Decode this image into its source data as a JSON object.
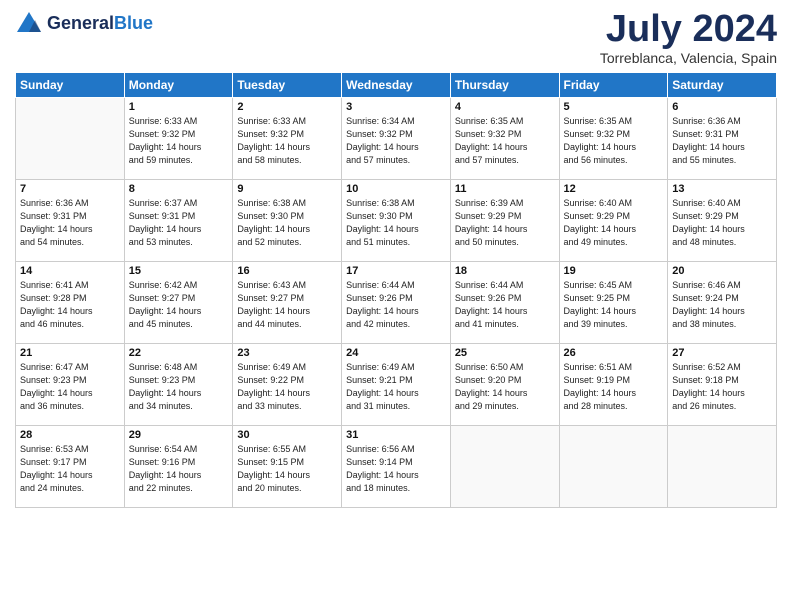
{
  "header": {
    "logo_line1": "General",
    "logo_line2": "Blue",
    "month_title": "July 2024",
    "location": "Torreblanca, Valencia, Spain"
  },
  "days_of_week": [
    "Sunday",
    "Monday",
    "Tuesday",
    "Wednesday",
    "Thursday",
    "Friday",
    "Saturday"
  ],
  "weeks": [
    [
      {
        "day": "",
        "info": ""
      },
      {
        "day": "1",
        "info": "Sunrise: 6:33 AM\nSunset: 9:32 PM\nDaylight: 14 hours\nand 59 minutes."
      },
      {
        "day": "2",
        "info": "Sunrise: 6:33 AM\nSunset: 9:32 PM\nDaylight: 14 hours\nand 58 minutes."
      },
      {
        "day": "3",
        "info": "Sunrise: 6:34 AM\nSunset: 9:32 PM\nDaylight: 14 hours\nand 57 minutes."
      },
      {
        "day": "4",
        "info": "Sunrise: 6:35 AM\nSunset: 9:32 PM\nDaylight: 14 hours\nand 57 minutes."
      },
      {
        "day": "5",
        "info": "Sunrise: 6:35 AM\nSunset: 9:32 PM\nDaylight: 14 hours\nand 56 minutes."
      },
      {
        "day": "6",
        "info": "Sunrise: 6:36 AM\nSunset: 9:31 PM\nDaylight: 14 hours\nand 55 minutes."
      }
    ],
    [
      {
        "day": "7",
        "info": "Sunrise: 6:36 AM\nSunset: 9:31 PM\nDaylight: 14 hours\nand 54 minutes."
      },
      {
        "day": "8",
        "info": "Sunrise: 6:37 AM\nSunset: 9:31 PM\nDaylight: 14 hours\nand 53 minutes."
      },
      {
        "day": "9",
        "info": "Sunrise: 6:38 AM\nSunset: 9:30 PM\nDaylight: 14 hours\nand 52 minutes."
      },
      {
        "day": "10",
        "info": "Sunrise: 6:38 AM\nSunset: 9:30 PM\nDaylight: 14 hours\nand 51 minutes."
      },
      {
        "day": "11",
        "info": "Sunrise: 6:39 AM\nSunset: 9:29 PM\nDaylight: 14 hours\nand 50 minutes."
      },
      {
        "day": "12",
        "info": "Sunrise: 6:40 AM\nSunset: 9:29 PM\nDaylight: 14 hours\nand 49 minutes."
      },
      {
        "day": "13",
        "info": "Sunrise: 6:40 AM\nSunset: 9:29 PM\nDaylight: 14 hours\nand 48 minutes."
      }
    ],
    [
      {
        "day": "14",
        "info": "Sunrise: 6:41 AM\nSunset: 9:28 PM\nDaylight: 14 hours\nand 46 minutes."
      },
      {
        "day": "15",
        "info": "Sunrise: 6:42 AM\nSunset: 9:27 PM\nDaylight: 14 hours\nand 45 minutes."
      },
      {
        "day": "16",
        "info": "Sunrise: 6:43 AM\nSunset: 9:27 PM\nDaylight: 14 hours\nand 44 minutes."
      },
      {
        "day": "17",
        "info": "Sunrise: 6:44 AM\nSunset: 9:26 PM\nDaylight: 14 hours\nand 42 minutes."
      },
      {
        "day": "18",
        "info": "Sunrise: 6:44 AM\nSunset: 9:26 PM\nDaylight: 14 hours\nand 41 minutes."
      },
      {
        "day": "19",
        "info": "Sunrise: 6:45 AM\nSunset: 9:25 PM\nDaylight: 14 hours\nand 39 minutes."
      },
      {
        "day": "20",
        "info": "Sunrise: 6:46 AM\nSunset: 9:24 PM\nDaylight: 14 hours\nand 38 minutes."
      }
    ],
    [
      {
        "day": "21",
        "info": "Sunrise: 6:47 AM\nSunset: 9:23 PM\nDaylight: 14 hours\nand 36 minutes."
      },
      {
        "day": "22",
        "info": "Sunrise: 6:48 AM\nSunset: 9:23 PM\nDaylight: 14 hours\nand 34 minutes."
      },
      {
        "day": "23",
        "info": "Sunrise: 6:49 AM\nSunset: 9:22 PM\nDaylight: 14 hours\nand 33 minutes."
      },
      {
        "day": "24",
        "info": "Sunrise: 6:49 AM\nSunset: 9:21 PM\nDaylight: 14 hours\nand 31 minutes."
      },
      {
        "day": "25",
        "info": "Sunrise: 6:50 AM\nSunset: 9:20 PM\nDaylight: 14 hours\nand 29 minutes."
      },
      {
        "day": "26",
        "info": "Sunrise: 6:51 AM\nSunset: 9:19 PM\nDaylight: 14 hours\nand 28 minutes."
      },
      {
        "day": "27",
        "info": "Sunrise: 6:52 AM\nSunset: 9:18 PM\nDaylight: 14 hours\nand 26 minutes."
      }
    ],
    [
      {
        "day": "28",
        "info": "Sunrise: 6:53 AM\nSunset: 9:17 PM\nDaylight: 14 hours\nand 24 minutes."
      },
      {
        "day": "29",
        "info": "Sunrise: 6:54 AM\nSunset: 9:16 PM\nDaylight: 14 hours\nand 22 minutes."
      },
      {
        "day": "30",
        "info": "Sunrise: 6:55 AM\nSunset: 9:15 PM\nDaylight: 14 hours\nand 20 minutes."
      },
      {
        "day": "31",
        "info": "Sunrise: 6:56 AM\nSunset: 9:14 PM\nDaylight: 14 hours\nand 18 minutes."
      },
      {
        "day": "",
        "info": ""
      },
      {
        "day": "",
        "info": ""
      },
      {
        "day": "",
        "info": ""
      }
    ]
  ]
}
